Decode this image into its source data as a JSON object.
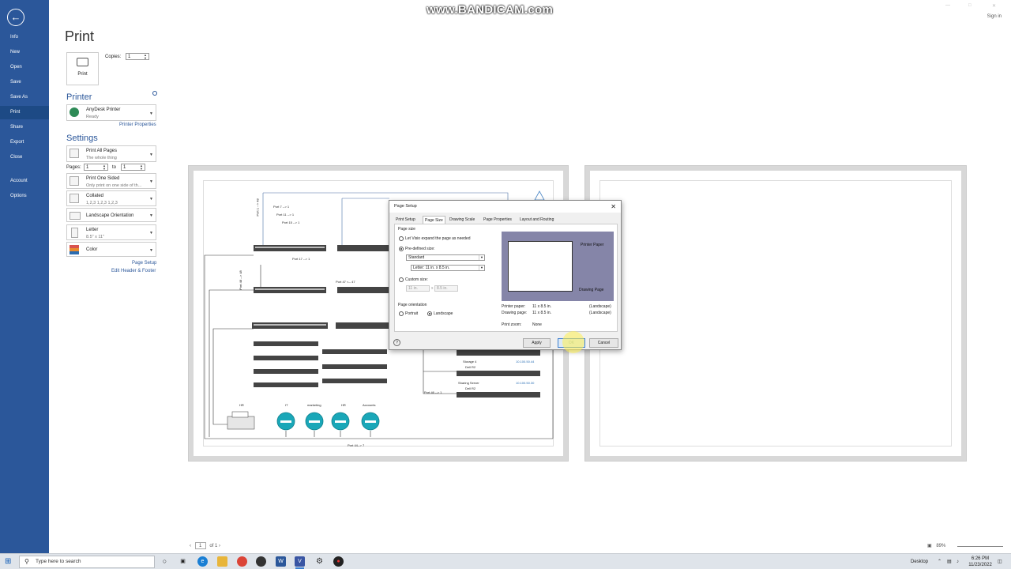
{
  "watermark": "www.BANDICAM.com",
  "signin": "Sign in",
  "nav": {
    "items": [
      "Info",
      "New",
      "Open",
      "Save",
      "Save As",
      "Print",
      "Share",
      "Export",
      "Close",
      "Account",
      "Options"
    ],
    "active": "Print"
  },
  "print": {
    "title": "Print",
    "button_label": "Print",
    "copies_label": "Copies:",
    "copies_value": "1"
  },
  "printer": {
    "heading": "Printer",
    "name": "AnyDesk Printer",
    "status": "Ready",
    "properties_link": "Printer Properties"
  },
  "settings": {
    "heading": "Settings",
    "pages_mode": "Print All Pages",
    "pages_mode_sub": "The whole thing",
    "pages_label": "Pages:",
    "pages_from": "1",
    "to_label": "to",
    "pages_to": "1",
    "sided": "Print One Sided",
    "sided_sub": "Only print on one side of th...",
    "collate": "Collated",
    "collate_sub": "1,2,3    1,2,3    1,2,3",
    "orientation": "Landscape Orientation",
    "paper": "Letter",
    "paper_sub": "8.5\" x 11\"",
    "color": "Color",
    "page_setup_link": "Page Setup",
    "header_footer_link": "Edit Header & Footer"
  },
  "diagram": {
    "labels": [
      "Port 7 --> 1",
      "Port 11 --> 1",
      "Port 15 --> 1",
      "Port 17 --> 1",
      "Port 47 <-- 47",
      "Port 1 --> 48",
      "Port 48 --> 48",
      "Storage 4",
      "Dell R2",
      "10.100.50.44",
      "Sharing Server",
      "Dell R2",
      "10.100.50.30",
      "Port 46 --> 1",
      "HR",
      "IT",
      "marketing",
      "HR",
      "Accounts",
      "Port 44--> 7"
    ],
    "ips": [
      "10.100.50.44",
      "10.100.50.30"
    ]
  },
  "dialog": {
    "title": "Page Setup",
    "tabs": [
      "Print Setup",
      "Page Size",
      "Drawing Scale",
      "Page Properties",
      "Layout and Routing"
    ],
    "active_tab": "Page Size",
    "page_size_label": "Page size",
    "opt_expand": "Let Visio expand the page as needed",
    "opt_predefined": "Pre-defined size:",
    "predefined_value": "Standard",
    "predefined_size": "Letter:  11 in. x 8.5 in.",
    "opt_custom": "Custom size:",
    "custom_w": "11 in.",
    "custom_x": "x",
    "custom_h": "8.5 in.",
    "orientation_label": "Page orientation",
    "portrait": "Portrait",
    "landscape": "Landscape",
    "preview_printer_paper": "Printer Paper",
    "preview_drawing_page": "Drawing Page",
    "printer_paper_label": "Printer paper:",
    "printer_paper_value": "11 x 8.5 in.",
    "printer_paper_orient": "(Landscape)",
    "drawing_page_label": "Drawing page:",
    "drawing_page_value": "11 x 8.5 in.",
    "drawing_page_orient": "(Landscape)",
    "print_zoom_label": "Print zoom:",
    "print_zoom_value": "None",
    "apply": "Apply",
    "ok": "OK",
    "cancel": "Cancel"
  },
  "pager": {
    "current": "1",
    "of": "of 1"
  },
  "zoom": {
    "value": "89%"
  },
  "taskbar": {
    "search_placeholder": "Type here to search",
    "desktop": "Desktop",
    "time": "6:26 PM",
    "date": "11/23/2022"
  },
  "colors": {
    "nav": "#2b579a",
    "accent": "#2b579a",
    "teal": "#1aa7b8"
  }
}
